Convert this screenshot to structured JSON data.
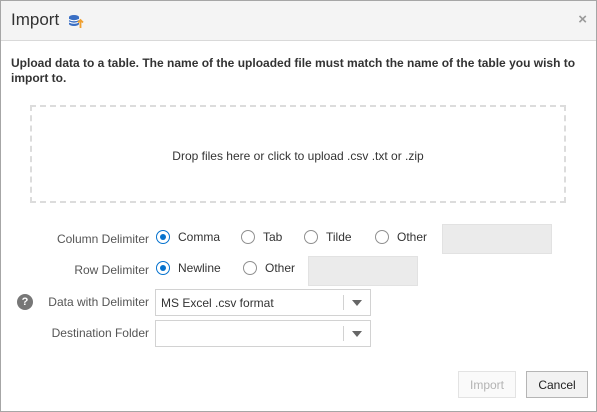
{
  "dialog": {
    "title": "Import",
    "title_icon": "database-upload-icon",
    "close_glyph": "×",
    "instructions": "Upload data to a table. The name of the uploaded file must match the name of the table you wish to import to."
  },
  "dropzone": {
    "text": "Drop files here or click to upload .csv .txt or .zip"
  },
  "column_delimiter": {
    "label": "Column Delimiter",
    "options": [
      {
        "label": "Comma",
        "checked": true
      },
      {
        "label": "Tab",
        "checked": false
      },
      {
        "label": "Tilde",
        "checked": false
      },
      {
        "label": "Other",
        "checked": false
      }
    ],
    "other_value": ""
  },
  "row_delimiter": {
    "label": "Row Delimiter",
    "options": [
      {
        "label": "Newline",
        "checked": true
      },
      {
        "label": "Other",
        "checked": false
      }
    ],
    "other_value": ""
  },
  "data_with_delimiter": {
    "label": "Data with Delimiter",
    "value": "MS Excel .csv format",
    "help_glyph": "?"
  },
  "destination_folder": {
    "label": "Destination Folder",
    "value": ""
  },
  "buttons": {
    "import_label": "Import",
    "import_enabled": false,
    "cancel_label": "Cancel"
  },
  "colors": {
    "accent": "#0572ce",
    "titlebar": "#f4f4f4",
    "disabled_text": "#b3b3b3"
  }
}
